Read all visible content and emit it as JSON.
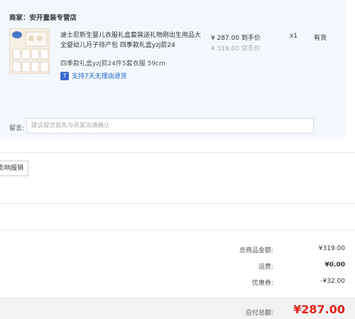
{
  "shop": {
    "name": "商家：安开童装专营店"
  },
  "product": {
    "title": "迪士尼新生婴儿衣服礼盒套装送礼物刚出生用品大全婴幼儿月子待产包 四季款礼盒yzj箭24",
    "variant": "四季款礼盒yzj箭24件5套衣服 59cm",
    "return_policy": "支持7天无理由退货",
    "return_icon_glyph": "7",
    "price_now": "¥ 287.00 到手价",
    "price_old": "¥ 319.00 京东价",
    "quantity": "x1",
    "stock": "有货"
  },
  "remark": {
    "label": "留言:",
    "placeholder": "建议留言前先与商家沟通确认"
  },
  "actions": {
    "report_label": "影响报销"
  },
  "summary": {
    "goods_total_label": "总商品金额:",
    "goods_total_value": "¥319.00",
    "shipping_label": "运费:",
    "shipping_value": "¥0.00",
    "coupon_label": "优惠券:",
    "coupon_value": "-¥32.00",
    "payable_label": "应付总额:",
    "payable_value": "¥287.00"
  },
  "colors": {
    "card_bg": "#f3f8fe",
    "price_red": "#e2231a",
    "return_blue": "#3a6bd1"
  }
}
